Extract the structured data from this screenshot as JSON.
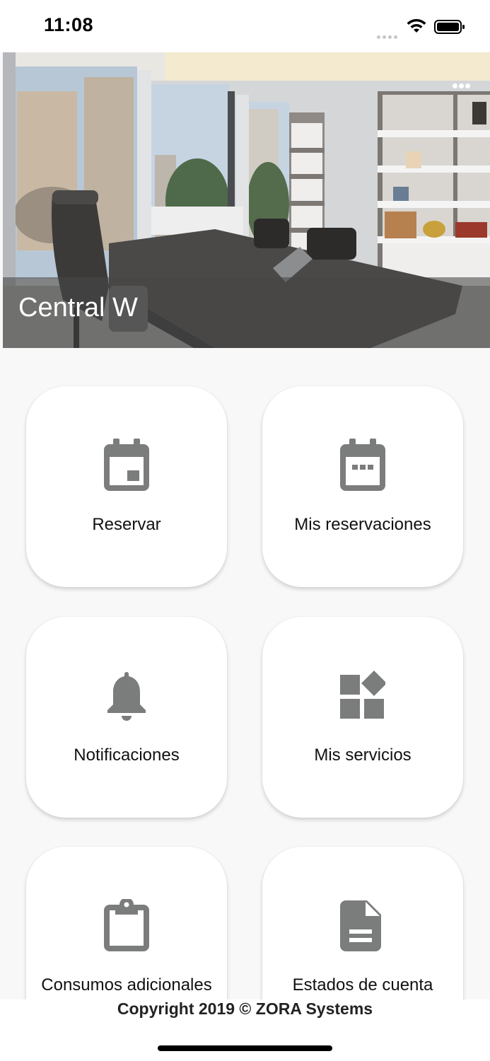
{
  "status_bar": {
    "time": "11:08"
  },
  "hero": {
    "title": "Central W",
    "more_icon": "more-horizontal-icon"
  },
  "menu": {
    "items": [
      {
        "label": "Reservar",
        "icon": "calendar-event-icon"
      },
      {
        "label": "Mis reservaciones",
        "icon": "calendar-dots-icon"
      },
      {
        "label": "Notificaciones",
        "icon": "bell-icon"
      },
      {
        "label": "Mis servicios",
        "icon": "widgets-icon"
      },
      {
        "label": "Consumos adicionales",
        "icon": "clipboard-icon"
      },
      {
        "label": "Estados de cuenta",
        "icon": "document-icon"
      }
    ]
  },
  "footer": {
    "copyright": "Copyright 2019 © ZORA Systems"
  },
  "colors": {
    "icon": "#7b7d7c",
    "tile_background": "#ffffff",
    "page_background": "#f8f8f8",
    "caption_overlay": "#464646"
  }
}
